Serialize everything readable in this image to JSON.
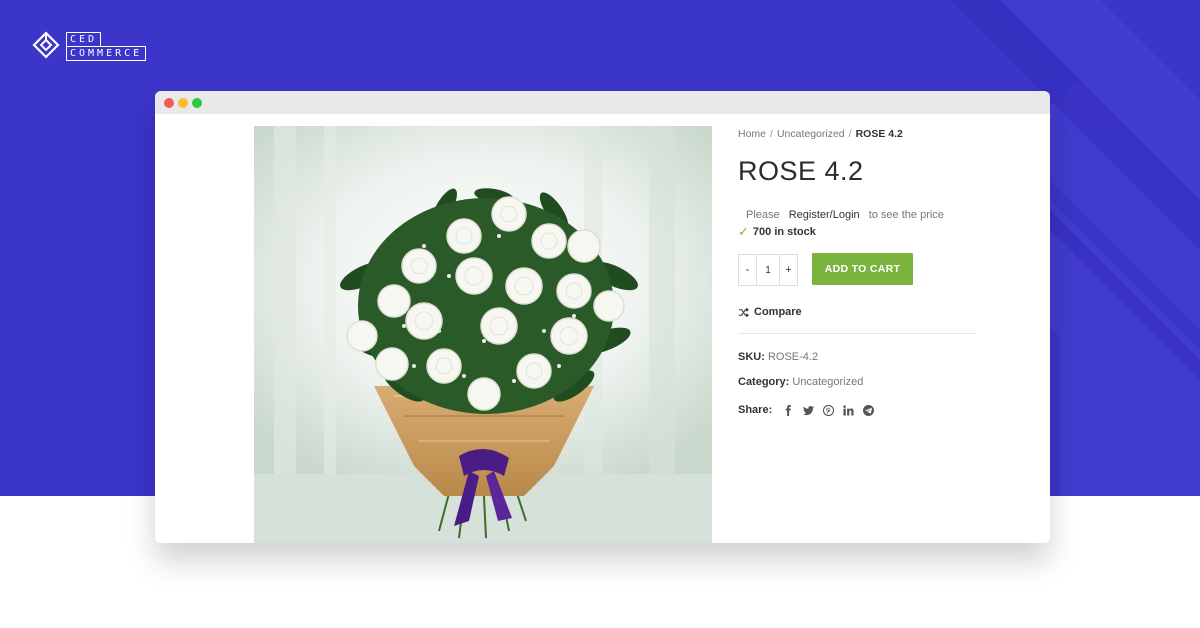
{
  "brand": {
    "line1": "CED",
    "line2": "COMMERCE"
  },
  "breadcrumb": {
    "items": [
      "Home",
      "Uncategorized"
    ],
    "separator": "/",
    "current": "ROSE 4.2"
  },
  "product": {
    "title": "ROSE 4.2",
    "price_note": {
      "before": "Please",
      "link": "Register/Login",
      "after": "to see the price"
    },
    "stock": "700 in stock",
    "quantity": {
      "minus": "-",
      "value": "1",
      "plus": "+"
    },
    "add_to_cart": "ADD TO CART",
    "compare": "Compare",
    "sku_label": "SKU:",
    "sku": "ROSE-4.2",
    "category_label": "Category:",
    "category": "Uncategorized",
    "share_label": "Share:",
    "share_icons": [
      "facebook-icon",
      "twitter-icon",
      "pinterest-icon",
      "linkedin-icon",
      "telegram-icon"
    ]
  },
  "colors": {
    "banner": "#3b35c9",
    "accent": "#7bb33f",
    "window_bar": "#e9e9e9"
  }
}
